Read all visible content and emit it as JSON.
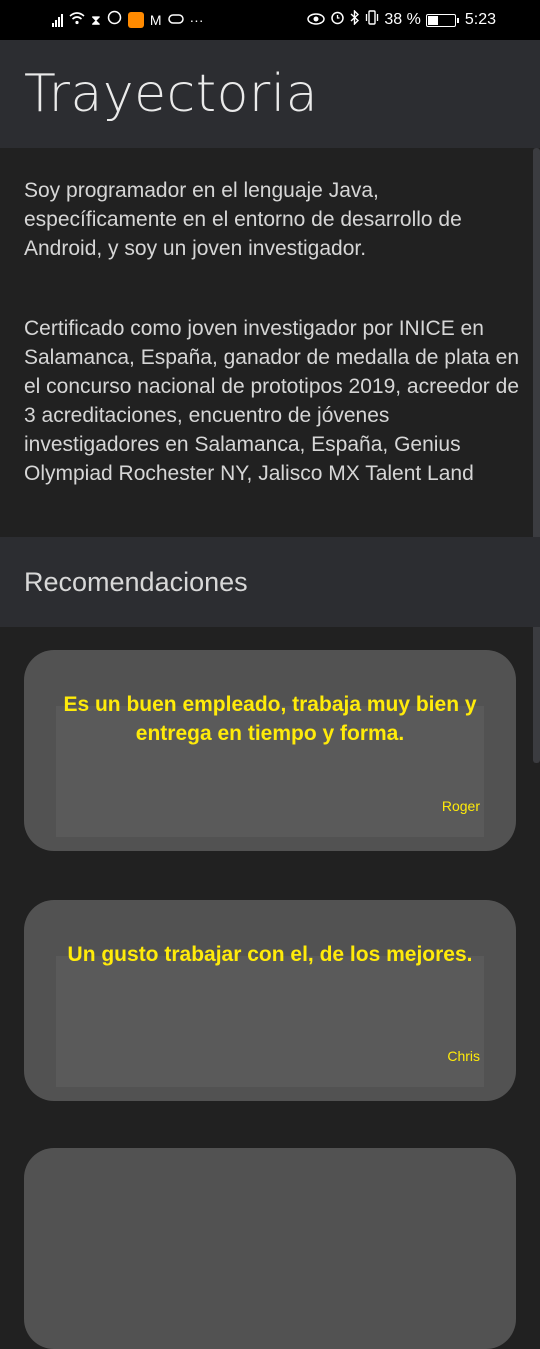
{
  "status_bar": {
    "left_icons": [
      "signal-icon",
      "wifi-icon",
      "hourglass-icon",
      "whatsapp-icon",
      "app-badge-icon",
      "gmail-icon",
      "game-controller-icon",
      "more-icon"
    ],
    "right_icons": [
      "eye-icon",
      "alarm-icon",
      "bluetooth-icon",
      "vibrate-icon"
    ],
    "battery_percent": "38 %",
    "battery_level": 0.38,
    "time": "5:23"
  },
  "header": {
    "title": "Trayectoria"
  },
  "content": {
    "paragraph1": "Soy programador en el lenguaje Java, específicamente en el entorno de desarrollo de Android, y soy un joven investigador.",
    "paragraph2": "Certificado como joven investigador por INICE en Salamanca, España, ganador de medalla de plata en el concurso nacional de prototipos 2019, acreedor de 3 acreditaciones, encuentro de jóvenes investigadores en Salamanca, España, Genius Olympiad Rochester NY, Jalisco MX Talent Land"
  },
  "recommendations": {
    "title": "Recomendaciones",
    "items": [
      {
        "text": "Es un buen empleado, trabaja muy bien y entrega en tiempo y forma.",
        "author": "Roger"
      },
      {
        "text": "Un gusto trabajar con el, de los mejores.",
        "author": "Chris"
      }
    ]
  },
  "colors": {
    "accent_text": "#ffeb0a",
    "card_background": "#525252",
    "app_bar": "#2c2d31",
    "background": "#212121"
  }
}
